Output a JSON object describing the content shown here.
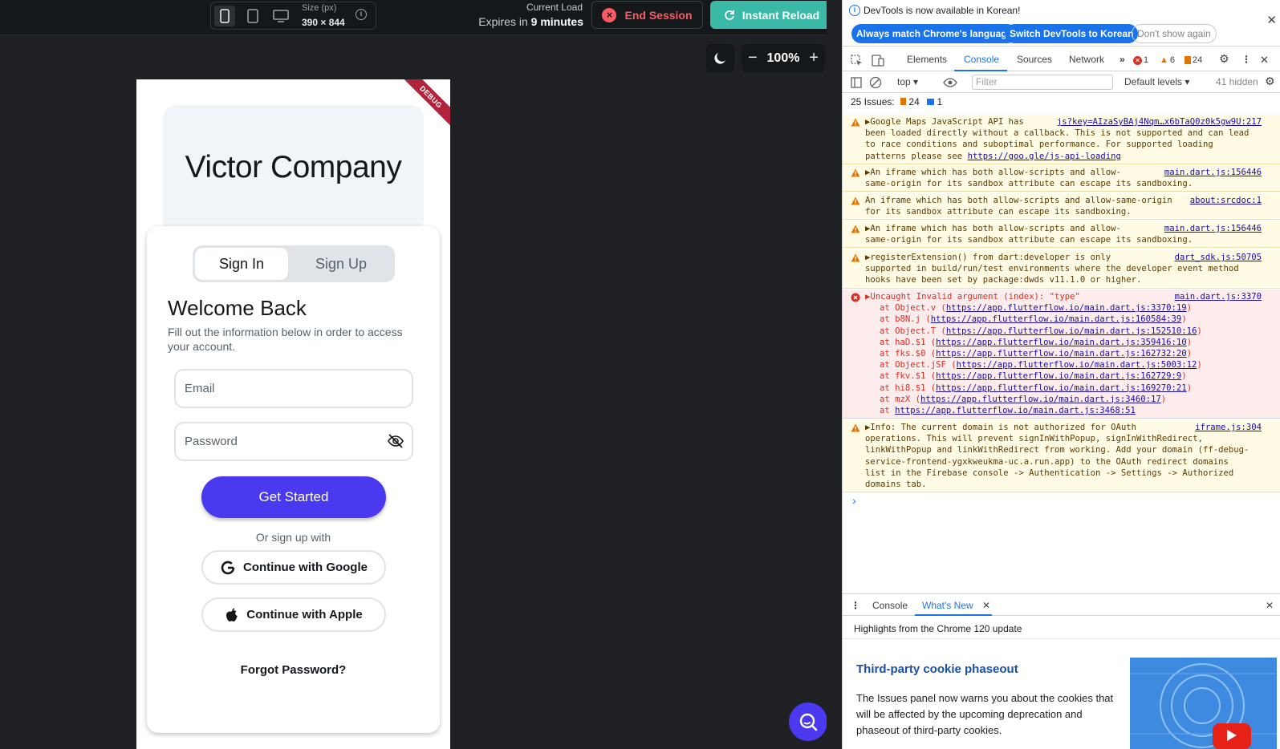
{
  "topbar": {
    "size_label": "Size (px)",
    "size_value": "390 × 844",
    "load_label": "Current Load",
    "expires_prefix": "Expires in",
    "expires_value": "9 minutes",
    "end_session": "End Session",
    "instant_reload": "Instant Reload",
    "zoom": "100%"
  },
  "app": {
    "company": "Victor Company",
    "debug": "DEBUG",
    "tabs": [
      "Sign In",
      "Sign Up"
    ],
    "welcome": "Welcome Back",
    "subtitle": "Fill out the information below in order to access your account.",
    "email_placeholder": "Email",
    "password_placeholder": "Password",
    "primary_button": "Get Started",
    "or_text": "Or sign up with",
    "google_button": "Continue with Google",
    "apple_button": "Continue with Apple",
    "forgot": "Forgot Password?"
  },
  "devtools": {
    "notice": "DevTools is now available in Korean!",
    "notice_buttons": [
      "Always match Chrome's language",
      "Switch DevTools to Korean",
      "Don't show again"
    ],
    "tabs": [
      "Elements",
      "Console",
      "Sources",
      "Network"
    ],
    "error_count": "1",
    "warn_count": "6",
    "issue_count": "24",
    "context": "top",
    "filter_placeholder": "Filter",
    "levels": "Default levels",
    "hidden": "41 hidden",
    "issues_label": "25 Issues:",
    "issues_warn": "24",
    "issues_info": "1",
    "messages": [
      {
        "type": "warn",
        "text": "▶Google Maps JavaScript API has\nbeen loaded directly without a callback. This is not supported and can lead\nto race conditions and suboptimal performance. For supported loading\npatterns please see ",
        "link": "https://goo.gle/js-api-loading",
        "source": "js?key=AIzaSyBAj4Nqm…x6bTaQ0z0k5gw9U:217"
      },
      {
        "type": "warn",
        "text": "▶An iframe which has both allow-scripts and allow-\nsame-origin for its sandbox attribute can escape its sandboxing.",
        "source": "main.dart.js:156446"
      },
      {
        "type": "warn",
        "text": "An iframe which has both allow-scripts and allow-same-origin\nfor its sandbox attribute can escape its sandboxing.",
        "source": "about:srcdoc:1"
      },
      {
        "type": "warn",
        "text": "▶An iframe which has both allow-scripts and allow-\nsame-origin for its sandbox attribute can escape its sandboxing.",
        "source": "main.dart.js:156446"
      },
      {
        "type": "warn",
        "text": "▶registerExtension() from dart:developer is only\nsupported in build/run/test environments where the developer event method\nhooks have been set by package:dwds v11.1.0 or higher.",
        "source": "dart_sdk.js:50705"
      },
      {
        "type": "err",
        "text": "▶Uncaught Invalid argument (index): \"type\"",
        "source": "main.dart.js:3370",
        "stack": [
          [
            "Object.v",
            "https://app.flutterflow.io/main.dart.js:3370:19"
          ],
          [
            "b8N.j",
            "https://app.flutterflow.io/main.dart.js:160584:39"
          ],
          [
            "Object.T",
            "https://app.flutterflow.io/main.dart.js:152510:16"
          ],
          [
            "haD.$1",
            "https://app.flutterflow.io/main.dart.js:359416:10"
          ],
          [
            "fks.$0",
            "https://app.flutterflow.io/main.dart.js:162732:20"
          ],
          [
            "Object.jSF",
            "https://app.flutterflow.io/main.dart.js:5003:12"
          ],
          [
            "fkv.$1",
            "https://app.flutterflow.io/main.dart.js:162729:9"
          ],
          [
            "hi8.$1",
            "https://app.flutterflow.io/main.dart.js:169270:21"
          ],
          [
            "mzX",
            "https://app.flutterflow.io/main.dart.js:3460:17"
          ],
          [
            "",
            "https://app.flutterflow.io/main.dart.js:3468:51"
          ]
        ]
      },
      {
        "type": "warn",
        "text": "▶Info: The current domain is not authorized for OAuth\noperations. This will prevent signInWithPopup, signInWithRedirect,\nlinkWithPopup and linkWithRedirect from working. Add your domain (ff-debug-\nservice-frontend-ygxkweukma-uc.a.run.app) to the OAuth redirect domains\nlist in the Firebase console -> Authentication -> Settings -> Authorized\ndomains tab.",
        "source": "iframe.js:304"
      }
    ],
    "drawer_tabs": [
      "Console",
      "What's New"
    ],
    "highlights": "Highlights from the Chrome 120 update",
    "whatsnew_title": "Third-party cookie phaseout",
    "whatsnew_text": "The Issues panel now warns you about the cookies that will be affected by the upcoming deprecation and phaseout of third-party cookies."
  },
  "colors": {
    "brand_primary": "#4b39ef",
    "reload_teal": "#39b9a6",
    "end_red": "#ff5963",
    "devtools_blue": "#1a73e8"
  }
}
